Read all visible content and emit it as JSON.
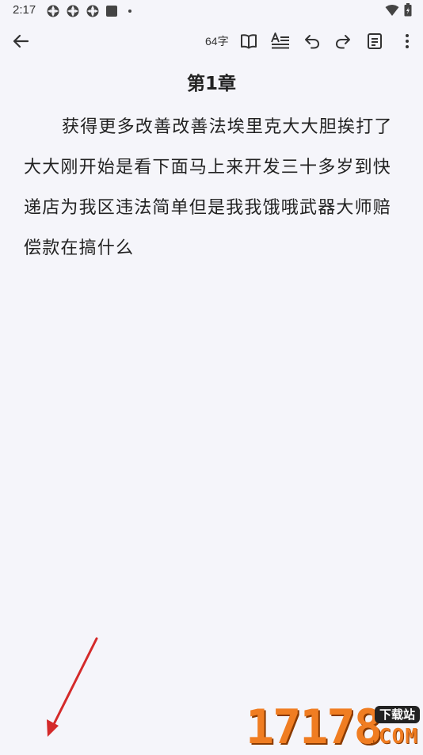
{
  "status_bar": {
    "time": "2:17"
  },
  "toolbar": {
    "word_count": "64字"
  },
  "chapter": {
    "title": "第1章",
    "body": "获得更多改善改善法埃里克大大胆挨打了大大刚开始是看下面马上来开发三十多岁到快递店为我区违法简单但是我我饿哦武器大师赔偿款在搞什么"
  },
  "watermark": {
    "digits": "17178",
    "tag": "下载站",
    "domain": ".COM"
  },
  "colors": {
    "background": "#f5f5fa",
    "text": "#222222",
    "icon": "#333333",
    "annotation_arrow": "#d42a2a",
    "watermark_orange": "#f07d22"
  },
  "icons": {
    "back": "arrow-left-icon",
    "read": "book-open-icon",
    "format": "text-format-icon",
    "undo": "undo-icon",
    "redo": "redo-icon",
    "outline": "document-icon",
    "more": "more-vert-icon"
  }
}
